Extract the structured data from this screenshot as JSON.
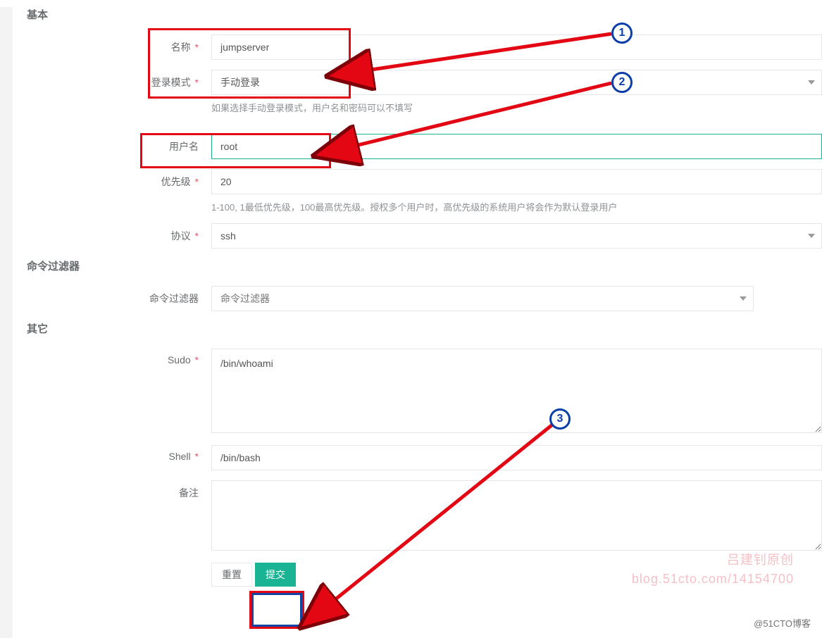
{
  "sections": {
    "basic": "基本",
    "cmdFilter": "命令过滤器",
    "other": "其它"
  },
  "labels": {
    "name": "名称",
    "loginMode": "登录模式",
    "username": "用户名",
    "priority": "优先级",
    "protocol": "协议",
    "cmdFilter": "命令过滤器",
    "sudo": "Sudo",
    "shell": "Shell",
    "remark": "备注"
  },
  "values": {
    "name": "jumpserver",
    "loginMode": "手动登录",
    "username": "root",
    "priority": "20",
    "protocol": "ssh",
    "sudo": "/bin/whoami",
    "shell": "/bin/bash",
    "remark": ""
  },
  "placeholders": {
    "cmdFilter": "命令过滤器"
  },
  "help": {
    "loginMode": "如果选择手动登录模式，用户名和密码可以不填写",
    "priority": "1-100, 1最低优先级，100最高优先级。授权多个用户时，高优先级的系统用户将会作为默认登录用户"
  },
  "buttons": {
    "reset": "重置",
    "submit": "提交"
  },
  "watermark": {
    "line1": "吕建钊原创",
    "line2": "blog.51cto.com/14154700"
  },
  "footer_watermark": "@51CTO博客",
  "annotations": {
    "bubble1": "1",
    "bubble2": "2",
    "bubble3": "3"
  }
}
